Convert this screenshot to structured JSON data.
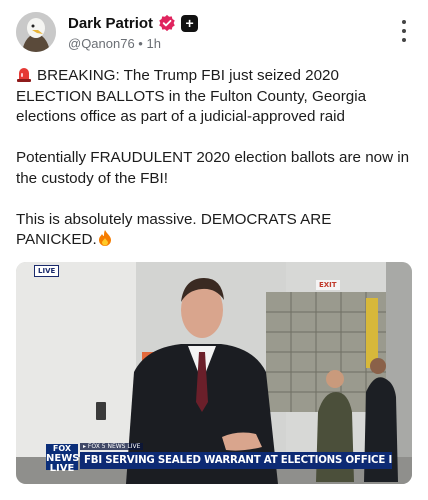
{
  "post": {
    "author_name": "Dark Patriot",
    "handle_time": "@Qanon76 • 1h",
    "badge_plus": "+",
    "paragraph1": "BREAKING: The Trump FBI just seized 2020 ELECTION BALLOTS in the Fulton County, Georgia elections office as part of a judicial-approved raid",
    "paragraph2": "Potentially FRAUDULENT 2020 election ballots are now in the custody of the FBI!",
    "paragraph3": "This is absolutely massive. DEMOCRATS ARE PANICKED.",
    "icons": {
      "verified": "verified-icon",
      "plus": "plus-badge-icon",
      "more": "more-options-icon",
      "siren": "siren-emoji",
      "fire": "fire-emoji"
    }
  },
  "video": {
    "live_tag": "LIVE",
    "exit_sign": "EXIT",
    "logo_top": "FOX",
    "logo_middle": "NEWS",
    "logo_bottom": "LIVE",
    "subline": "▸ FOX 5 NEWS LIVE",
    "chyron": "FBI SERVING SEALED WARRANT AT ELECTIONS OFFICE IN FULTON COUNTY"
  },
  "colors": {
    "verified_pink": "#e0245e",
    "chyron_blue": "#0d2a74",
    "text": "#1c1c1c",
    "muted": "#6b6f75"
  }
}
